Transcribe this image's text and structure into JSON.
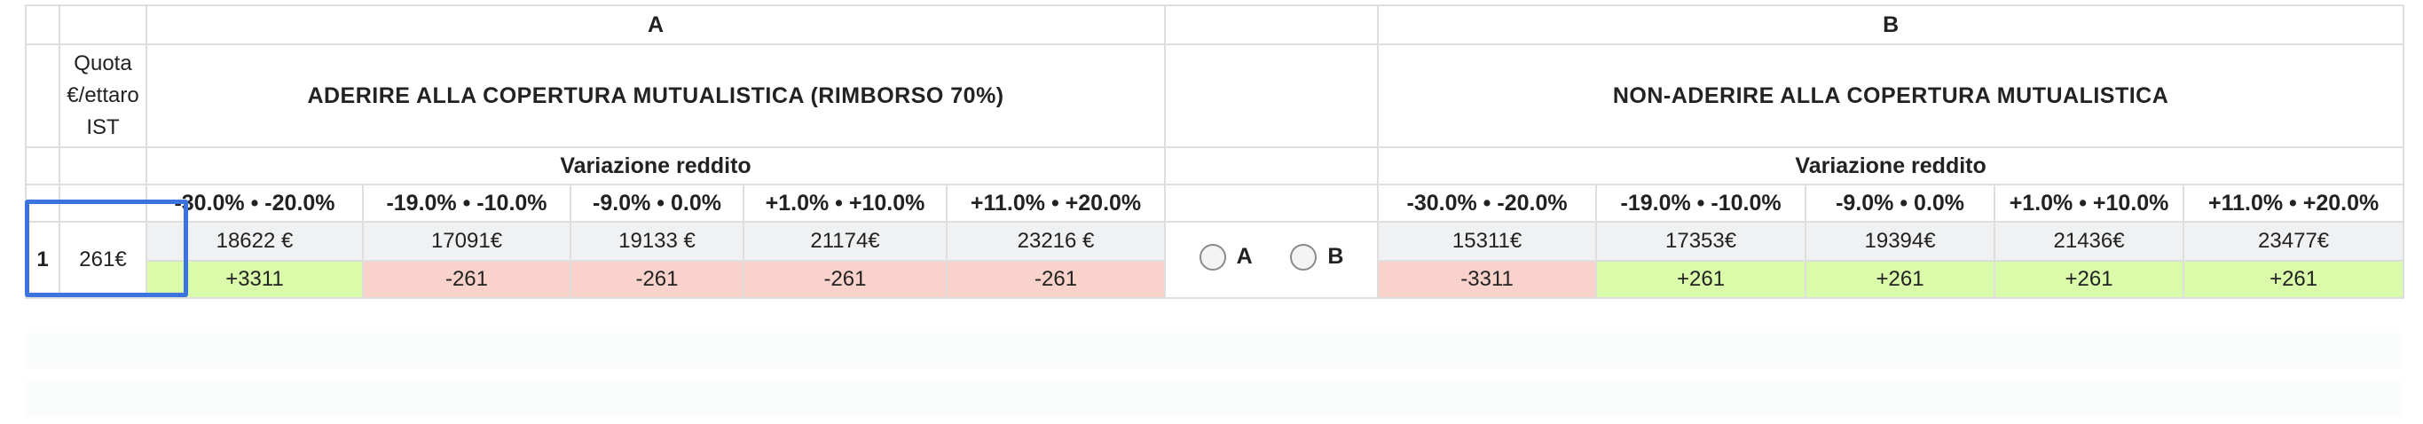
{
  "groups": {
    "a_label": "A",
    "b_label": "B"
  },
  "columns": {
    "quota_header": [
      "Quota",
      "€/ettaro",
      "IST"
    ],
    "option_a_title": "ADERIRE ALLA COPERTURA MUTUALISTICA (RIMBORSO 70%)",
    "option_b_title": "NON-ADERIRE ALLA COPERTURA MUTUALISTICA",
    "variation_label_a": "Variazione reddito",
    "variation_label_b": "Variazione reddito",
    "ranges": [
      "-30.0% • -20.0%",
      "-19.0% • -10.0%",
      "-9.0% • 0.0%",
      "+1.0% • +10.0%",
      "+11.0% • +20.0%"
    ]
  },
  "rows": [
    {
      "number": "1",
      "quota": "261€",
      "a_values": [
        "18622 €",
        "17091€",
        "19133 €",
        "21174€",
        "23216 €"
      ],
      "a_diffs": [
        "+3311",
        "-261",
        "-261",
        "-261",
        "-261"
      ],
      "b_values": [
        "15311€",
        "17353€",
        "19394€",
        "21436€",
        "23477€"
      ],
      "b_diffs": [
        "-3311",
        "+261",
        "+261",
        "+261",
        "+261"
      ],
      "choice_a_label": "A",
      "choice_b_label": "B"
    }
  ],
  "colors": {
    "positive": "#d9fbaa",
    "negative": "#f9d3cb",
    "value_bg": "#eff1f2",
    "focus": "#3b74de"
  }
}
